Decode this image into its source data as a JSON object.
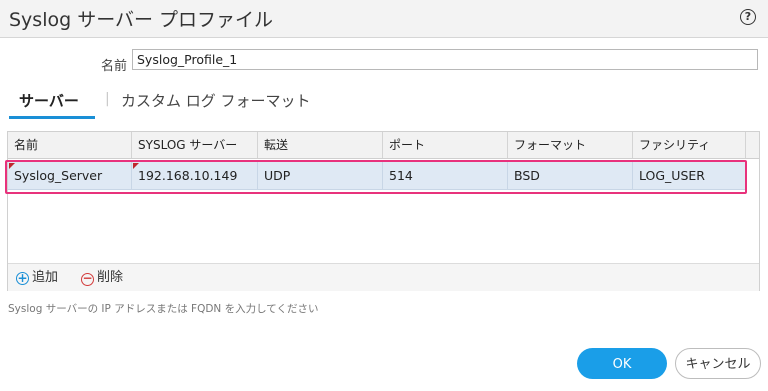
{
  "dialog": {
    "title": "Syslog サーバー プロファイル",
    "help_glyph": "?"
  },
  "name_field": {
    "label": "名前",
    "value": "Syslog_Profile_1"
  },
  "tabs": {
    "active": "サーバー",
    "separator": "|",
    "inactive": "カスタム ログ フォーマット"
  },
  "table": {
    "headers": [
      "名前",
      "SYSLOG サーバー",
      "転送",
      "ポート",
      "フォーマット",
      "ファシリティ"
    ],
    "rows": [
      {
        "name": "Syslog_Server",
        "server": "192.168.10.149",
        "transport": "UDP",
        "port": "514",
        "format": "BSD",
        "facility": "LOG_USER",
        "selected": true
      }
    ]
  },
  "footer": {
    "add_label": "追加",
    "delete_label": "削除"
  },
  "hint_text": "Syslog サーバーの IP アドレスまたは FQDN を入力してください",
  "buttons": {
    "ok": "OK",
    "cancel": "キャンセル"
  },
  "colors": {
    "accent": "#1a9ee8",
    "highlight": "#e8327c",
    "error_marker": "#c0262e",
    "selected_row": "#dfe9f4"
  }
}
